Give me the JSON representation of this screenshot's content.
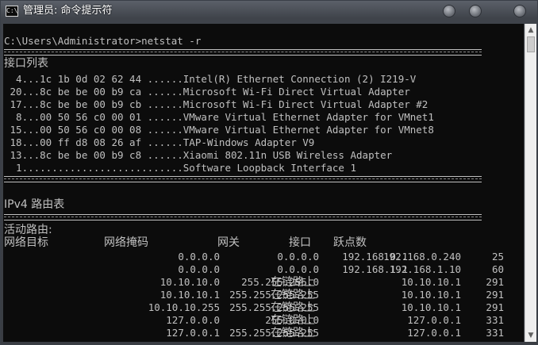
{
  "window": {
    "title": "管理员: 命令提示符",
    "icon_label": "C:\\"
  },
  "console": {
    "prompt": "C:\\Users\\Administrator>netstat -r",
    "interface_list_heading": "接口列表",
    "interfaces": [
      "  4...1c 1b 0d 02 62 44 ......Intel(R) Ethernet Connection (2) I219-V",
      " 20...8c be be 00 b9 ca ......Microsoft Wi-Fi Direct Virtual Adapter",
      " 17...8c be be 00 b9 cb ......Microsoft Wi-Fi Direct Virtual Adapter #2",
      "  8...00 50 56 c0 00 01 ......VMware Virtual Ethernet Adapter for VMnet1",
      " 15...00 50 56 c0 00 08 ......VMware Virtual Ethernet Adapter for VMnet8",
      " 18...00 ff d8 08 26 af ......TAP-Windows Adapter V9",
      " 13...8c be be 00 b9 c8 ......Xiaomi 802.11n USB Wireless Adapter",
      "  1...........................Software Loopback Interface 1"
    ],
    "ipv4_heading": "IPv4 路由表",
    "active_routes_heading": "活动路由:",
    "columns": [
      "网络目标",
      "网络掩码",
      "网关",
      "接口",
      "跃点数"
    ],
    "routes": [
      [
        "0.0.0.0",
        "0.0.0.0",
        "192.168.0.1",
        "192.168.0.240",
        "25"
      ],
      [
        "0.0.0.0",
        "0.0.0.0",
        "192.168.1.1",
        "192.168.1.10",
        "60"
      ],
      [
        "10.10.10.0",
        "255.255.255.0",
        "在链路上",
        "10.10.10.1",
        "291"
      ],
      [
        "10.10.10.1",
        "255.255.255.255",
        "在链路上",
        "10.10.10.1",
        "291"
      ],
      [
        "10.10.10.255",
        "255.255.255.255",
        "在链路上",
        "10.10.10.1",
        "291"
      ],
      [
        "127.0.0.0",
        "255.0.0.0",
        "在链路上",
        "127.0.0.1",
        "331"
      ],
      [
        "127.0.0.1",
        "255.255.255.255",
        "在链路上",
        "127.0.0.1",
        "331"
      ]
    ]
  },
  "scrollbar": {
    "up_arrow": "▲",
    "down_arrow": "▼"
  }
}
